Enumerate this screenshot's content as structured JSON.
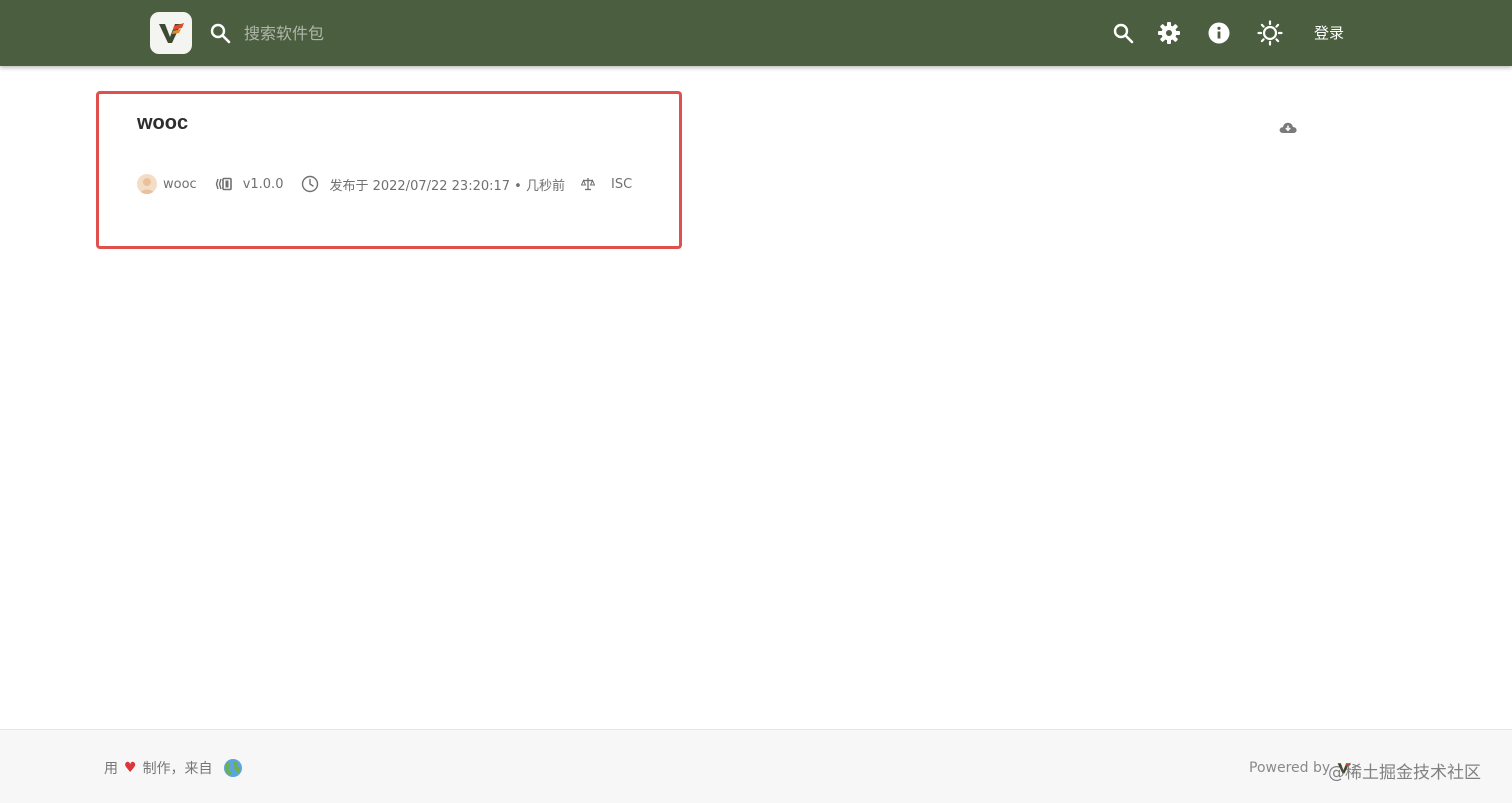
{
  "header": {
    "search_placeholder": "搜索软件包",
    "login_label": "登录",
    "icons": [
      "search-icon",
      "gear-icon",
      "info-icon",
      "sun-icon"
    ],
    "background_color": "#4b5e40"
  },
  "package": {
    "name": "wooc",
    "author": "wooc",
    "version": "v1.0.0",
    "published": "发布于 2022/07/22 23:20:17 • 几秒前",
    "license": "ISC",
    "highlight_color": "#e0514e"
  },
  "footer": {
    "made_with_prefix": "用",
    "heart": "♥",
    "made_with_suffix": "制作，来自",
    "powered_by": "Powered by",
    "watermark": "@稀土掘金技术社区"
  }
}
